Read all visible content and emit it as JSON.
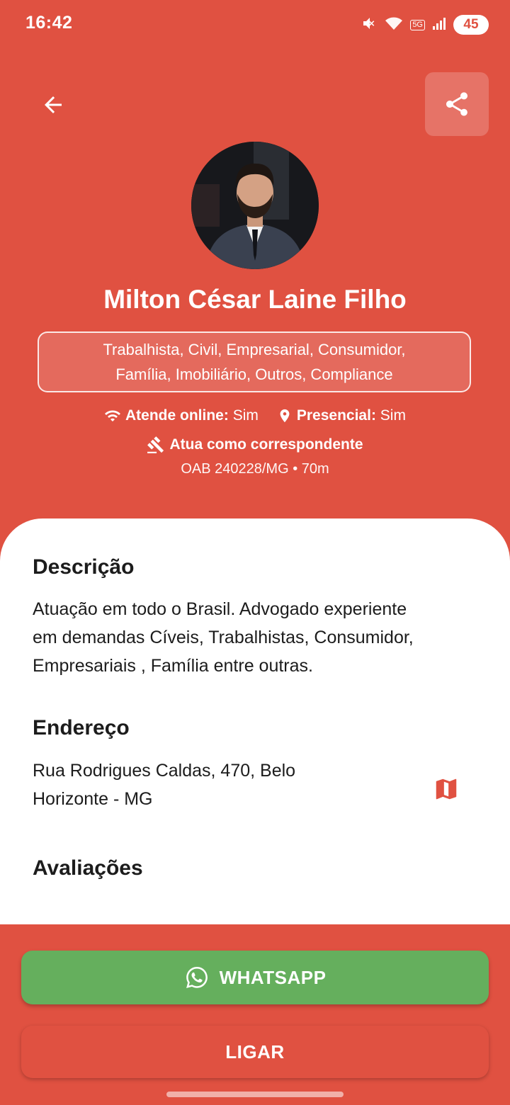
{
  "status_bar": {
    "time": "16:42",
    "network": "5G",
    "battery": "45"
  },
  "header": {
    "back_icon": "arrow-left-icon",
    "share_icon": "share-icon"
  },
  "profile": {
    "name": "Milton César Laine Filho",
    "areas_line1": "Trabalhista, Civil, Empresarial, Consumidor,",
    "areas_line2": "Família, Imobiliário, Outros, Compliance",
    "online_label": "Atende online:",
    "online_value": "Sim",
    "presencial_label": "Presencial:",
    "presencial_value": "Sim",
    "correspondent": "Atua como correspondente",
    "oab": "OAB 240228/MG • 70m"
  },
  "details": {
    "description_title": "Descrição",
    "description_line1": "Atuação em todo o Brasil. Advogado experiente",
    "description_line2": "em demandas Cíveis, Trabalhistas, Consumidor,",
    "description_line3": "Empresariais , Família entre outras.",
    "address_title": "Endereço",
    "address_line1": "Rua Rodrigues Caldas, 470, Belo",
    "address_line2": "Horizonte - MG",
    "reviews_title": "Avaliações"
  },
  "actions": {
    "whatsapp": "WHATSAPP",
    "call": "LIGAR"
  },
  "colors": {
    "primary": "#E05141",
    "whatsapp": "#65AF5D",
    "card": "#FFFFFF"
  }
}
